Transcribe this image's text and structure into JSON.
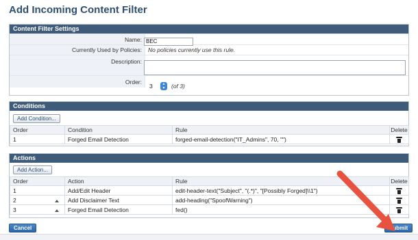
{
  "page": {
    "title": "Add Incoming Content Filter"
  },
  "settings": {
    "header": "Content Filter Settings",
    "name_label": "Name:",
    "name_value": "BEC",
    "policies_label": "Currently Used by Policies:",
    "policies_value": "No policies currently use this rule.",
    "description_label": "Description:",
    "description_value": "",
    "order_label": "Order:",
    "order_value": "3",
    "order_of": "(of 3)"
  },
  "conditions": {
    "header": "Conditions",
    "add_button": "Add Condition...",
    "columns": {
      "order": "Order",
      "condition": "Condition",
      "rule": "Rule",
      "delete": "Delete"
    },
    "rows": [
      {
        "order": "1",
        "name": "Forged Email Detection",
        "rule": "forged-email-detection(\"IT_Admins\", 70, \"\")"
      }
    ]
  },
  "actions": {
    "header": "Actions",
    "add_button": "Add Action...",
    "columns": {
      "order": "Order",
      "action": "Action",
      "rule": "Rule",
      "delete": "Delete"
    },
    "rows": [
      {
        "order": "1",
        "name": "Add/Edit Header",
        "rule": "edit-header-text(\"Subject\", \"(.*)\", \"[Possibly Forged]\\\\1\")",
        "move_up": false
      },
      {
        "order": "2",
        "name": "Add Disclaimer Text",
        "rule": "add-heading(\"SpoofWarning\")",
        "move_up": true
      },
      {
        "order": "3",
        "name": "Forged Email Detection",
        "rule": "fed()",
        "move_up": true
      }
    ]
  },
  "footer": {
    "cancel_label": "Cancel",
    "submit_label": "Submit"
  },
  "colors": {
    "header_bar": "#3f5b7a",
    "title": "#2e4d72",
    "link": "#1e5b96",
    "annotation_arrow": "#e8533f"
  },
  "icons": {
    "delete": "trash-icon",
    "move_up": "up-arrow-icon",
    "order_stepper": "stepper-icon"
  }
}
